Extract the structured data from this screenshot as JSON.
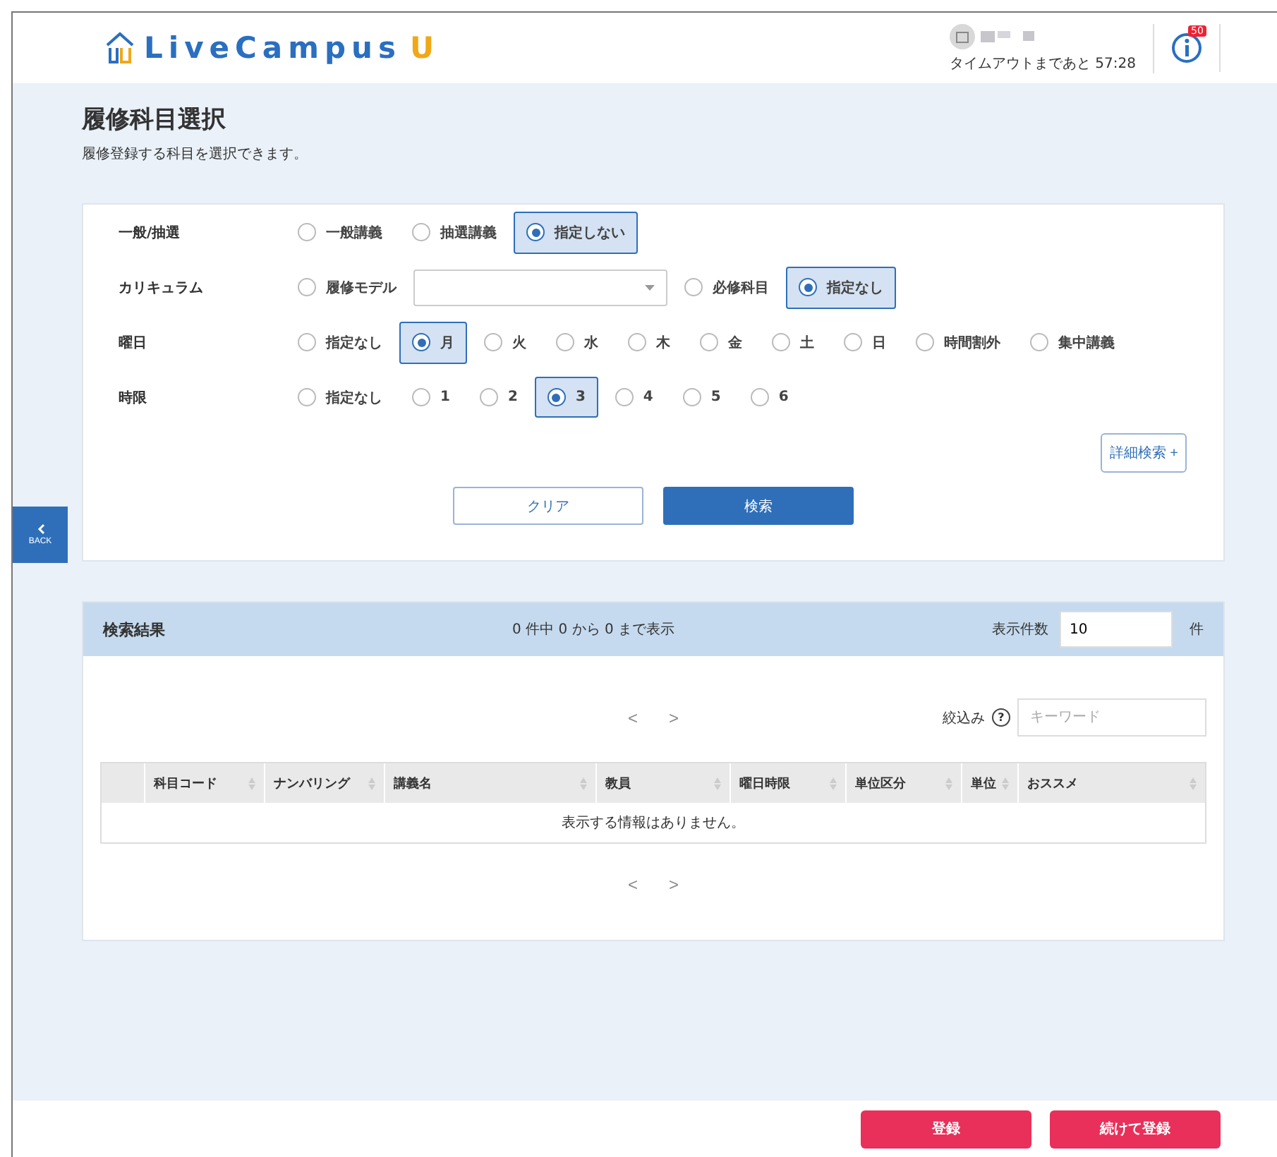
{
  "header": {
    "logo": "LiveCampus",
    "logo_suffix": "U",
    "timeout": "タイムアウトまであと 57:28",
    "notification_count": "50"
  },
  "page": {
    "title": "履修科目選択",
    "subtitle": "履修登録する科目を選択できます。"
  },
  "back_button": "BACK",
  "filters": [
    {
      "label": "一般/抽選",
      "options": [
        {
          "kind": "radio",
          "label": "一般講義",
          "selected": false
        },
        {
          "kind": "radio",
          "label": "抽選講義",
          "selected": false
        },
        {
          "kind": "radio",
          "label": "指定しない",
          "selected": true
        }
      ]
    },
    {
      "label": "カリキュラム",
      "options": [
        {
          "kind": "radio",
          "label": "履修モデル",
          "selected": false
        },
        {
          "kind": "select"
        },
        {
          "kind": "radio",
          "label": "必修科目",
          "selected": false
        },
        {
          "kind": "radio",
          "label": "指定なし",
          "selected": true
        }
      ]
    },
    {
      "label": "曜日",
      "options": [
        {
          "kind": "radio",
          "label": "指定なし",
          "selected": false
        },
        {
          "kind": "radio",
          "label": "月",
          "selected": true
        },
        {
          "kind": "radio",
          "label": "火",
          "selected": false
        },
        {
          "kind": "radio",
          "label": "水",
          "selected": false
        },
        {
          "kind": "radio",
          "label": "木",
          "selected": false
        },
        {
          "kind": "radio",
          "label": "金",
          "selected": false
        },
        {
          "kind": "radio",
          "label": "土",
          "selected": false
        },
        {
          "kind": "radio",
          "label": "日",
          "selected": false
        },
        {
          "kind": "radio",
          "label": "時間割外",
          "selected": false
        },
        {
          "kind": "radio",
          "label": "集中講義",
          "selected": false
        }
      ]
    },
    {
      "label": "時限",
      "options": [
        {
          "kind": "radio",
          "label": "指定なし",
          "selected": false
        },
        {
          "kind": "radio",
          "label": "1",
          "selected": false
        },
        {
          "kind": "radio",
          "label": "2",
          "selected": false
        },
        {
          "kind": "radio",
          "label": "3",
          "selected": true
        },
        {
          "kind": "radio",
          "label": "4",
          "selected": false
        },
        {
          "kind": "radio",
          "label": "5",
          "selected": false
        },
        {
          "kind": "radio",
          "label": "6",
          "selected": false
        }
      ]
    }
  ],
  "advanced_search": "詳細検索 +",
  "clear_button": "クリア",
  "search_button": "検索",
  "results": {
    "title": "検索結果",
    "summary": "0 件中 0 から 0 まで表示",
    "per_page_label": "表示件数",
    "per_page": "10",
    "per_page_unit": "件",
    "pager": {
      "prev": "<",
      "next": ">"
    },
    "filter_label": "絞込み",
    "filter_help": "?",
    "filter_placeholder": "キーワード",
    "columns": [
      "",
      "科目コード",
      "ナンバリング",
      "講義名",
      "教員",
      "曜日時限",
      "単位区分",
      "単位",
      "おススメ"
    ],
    "empty": "表示する情報はありません。",
    "pager_bottom": {
      "prev": "<",
      "next": ">"
    }
  },
  "footer": {
    "buttons": [
      "登録",
      "続けて登録"
    ]
  }
}
